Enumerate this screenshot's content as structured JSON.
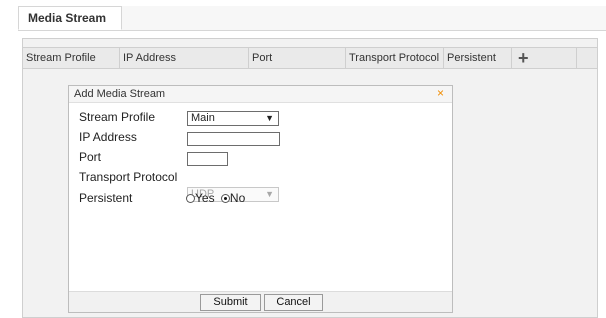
{
  "tabs": [
    {
      "label": "Media Stream"
    }
  ],
  "table": {
    "columns": [
      "Stream Profile",
      "IP Address",
      "Port",
      "Transport Protocol",
      "Persistent"
    ],
    "add_label": "+"
  },
  "dialog": {
    "title": "Add Media Stream",
    "close_label": "×",
    "fields": {
      "stream_profile": {
        "label": "Stream Profile",
        "value": "Main"
      },
      "ip_address": {
        "label": "IP Address",
        "value": ""
      },
      "port": {
        "label": "Port",
        "value": ""
      },
      "transport_protocol": {
        "label": "Transport Protocol",
        "value": "UDP"
      },
      "persistent": {
        "label": "Persistent",
        "options": [
          "Yes",
          "No"
        ],
        "selected": "No"
      }
    },
    "buttons": {
      "submit": "Submit",
      "cancel": "Cancel"
    }
  },
  "colors": {
    "close_icon": "#f08c00",
    "panel_bg": "#f2f2f2"
  },
  "icons": {
    "add": "plus-icon",
    "close": "close-icon",
    "dropdown": "chevron-down-icon"
  }
}
